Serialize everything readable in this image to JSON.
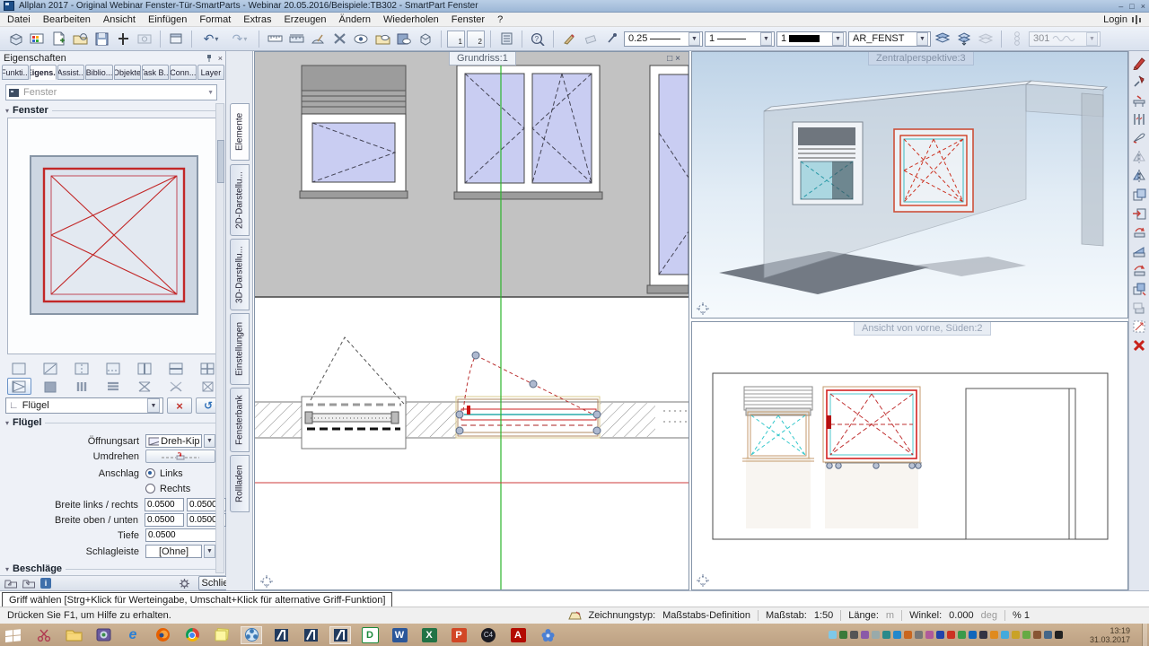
{
  "window": {
    "title": "Allplan 2017 - Original Webinar Fenster-Tür-SmartParts - Webinar 20.05.2016/Beispiele:TB302 - SmartPart Fenster",
    "login_label": "Login"
  },
  "menus": [
    "Datei",
    "Bearbeiten",
    "Ansicht",
    "Einfügen",
    "Format",
    "Extras",
    "Erzeugen",
    "Ändern",
    "Wiederholen",
    "Fenster",
    "?"
  ],
  "toolbar": {
    "pen_value": "0.25",
    "linetype_value": "1",
    "linecolor_value": "1",
    "layer_value": "AR_FENST",
    "surface_value": "301",
    "view1_label": "1",
    "view2_label": "2"
  },
  "panel": {
    "title": "Eigenschaften",
    "tabs": [
      "Funkti...",
      "Eigens...",
      "Assist...",
      "Biblio...",
      "Objekte",
      "Task B...",
      "Conn...",
      "Layer"
    ],
    "selector_placeholder": "Fenster",
    "section_fenster": "Fenster",
    "subobject_value": "Flügel",
    "section_fluegel": "Flügel",
    "fields": {
      "oeffnungsart_label": "Öffnungsart",
      "oeffnungsart_value": "Dreh-Kipp",
      "umdrehen_label": "Umdrehen",
      "anschlag_label": "Anschlag",
      "anschlag_options": [
        "Links",
        "Rechts"
      ],
      "breite_lr_label": "Breite links / rechts",
      "breite_lr_values": [
        "0.0500",
        "0.0500"
      ],
      "breite_ou_label": "Breite oben / unten",
      "breite_ou_values": [
        "0.0500",
        "0.0500"
      ],
      "tiefe_label": "Tiefe",
      "tiefe_value": "0.0500",
      "schlagleiste_label": "Schlagleiste",
      "schlagleiste_value": "[Ohne]"
    },
    "section_beschlaege": "Beschläge",
    "close_button": "Schließen"
  },
  "side_tabs": [
    "Elemente",
    "2D-Darstellu...",
    "3D-Darstellu...",
    "Einstellungen",
    "Fensterbank",
    "Rollladen"
  ],
  "viewports": {
    "plan_label": "Grundriss:1",
    "perspective_label": "Zentralperspektive:3",
    "front_label": "Ansicht von vorne, Süden:2"
  },
  "statusbar": {
    "hint": "Griff wählen [Strg+Klick für Werteingabe, Umschalt+Klick für alternative Griff-Funktion]",
    "help": "Drücken Sie F1, um Hilfe zu erhalten.",
    "zeichnungstyp_label": "Zeichnungstyp:",
    "zeichnungstyp_value": "Maßstabs-Definition",
    "massstab_label": "Maßstab:",
    "massstab_value": "1:50",
    "laenge_label": "Länge:",
    "laenge_value": "m",
    "winkel_label": "Winkel:",
    "winkel_value": "0.000",
    "winkel_unit": "deg",
    "scale_indicator": "% 1"
  },
  "taskbar": {
    "time": "13:19",
    "date": "31.03.2017"
  },
  "colors": {
    "selection_red": "#cc2222",
    "construction_green": "#2db32d",
    "aid_cyan": "#35c0c8",
    "glass_blue": "#c9cdf2"
  }
}
